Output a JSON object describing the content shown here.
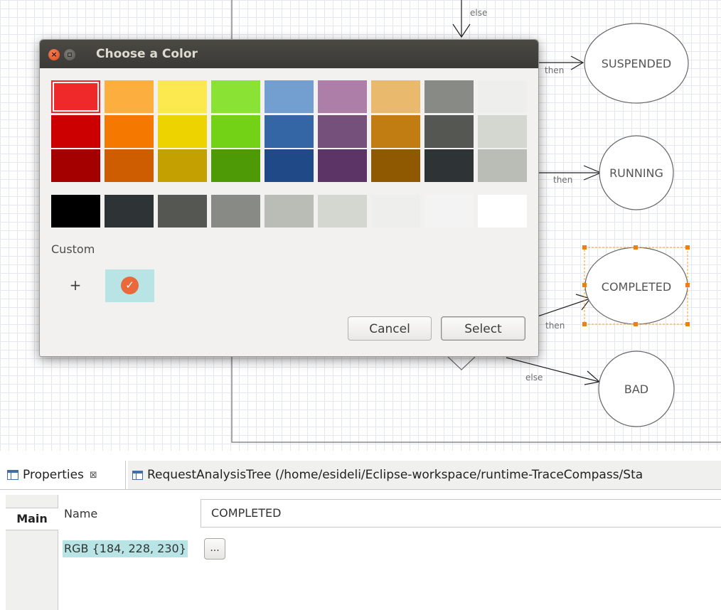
{
  "diagram": {
    "states": {
      "suspended": "SUSPENDED",
      "running": "RUNNING",
      "completed": "COMPLETED",
      "bad": "BAD"
    },
    "edge_labels": {
      "else_top": "else",
      "then_suspended": "then",
      "then_running": "then",
      "then_completed": "then",
      "else_bad": "else"
    }
  },
  "dialog": {
    "title": "Choose a Color",
    "close_glyph": "×",
    "custom_label": "Custom",
    "add_custom_glyph": "+",
    "custom_color": "#b8e4e6",
    "check_glyph": "✓",
    "cancel_label": "Cancel",
    "select_label": "Select",
    "palette_rows": [
      [
        "#ef2929",
        "#fcaf3e",
        "#fce94f",
        "#8ae234",
        "#729fcf",
        "#ad7fa8",
        "#e9b96e",
        "#888a85",
        "#eeeeec"
      ],
      [
        "#cc0000",
        "#f57900",
        "#edd400",
        "#73d216",
        "#3465a4",
        "#75507b",
        "#c17d11",
        "#555753",
        "#d3d7cf"
      ],
      [
        "#a40000",
        "#ce5c00",
        "#c4a000",
        "#4e9a06",
        "#204a87",
        "#5c3566",
        "#8f5902",
        "#2e3436",
        "#babdb6"
      ]
    ],
    "gray_row": [
      "#000000",
      "#2e3436",
      "#555753",
      "#888a85",
      "#babdb6",
      "#d3d7cf",
      "#eeeeec",
      "#f3f3f3",
      "#ffffff"
    ]
  },
  "properties": {
    "tab_title": "Properties",
    "close_glyph": "⊠",
    "other_tab": "RequestAnalysisTree (/home/esideli/Eclipse-workspace/runtime-TraceCompass/Sta",
    "side_tab": "Main",
    "name_label": "Name",
    "name_value": "COMPLETED",
    "color_value": "RGB {184, 228, 230}",
    "picker_button": "..."
  }
}
